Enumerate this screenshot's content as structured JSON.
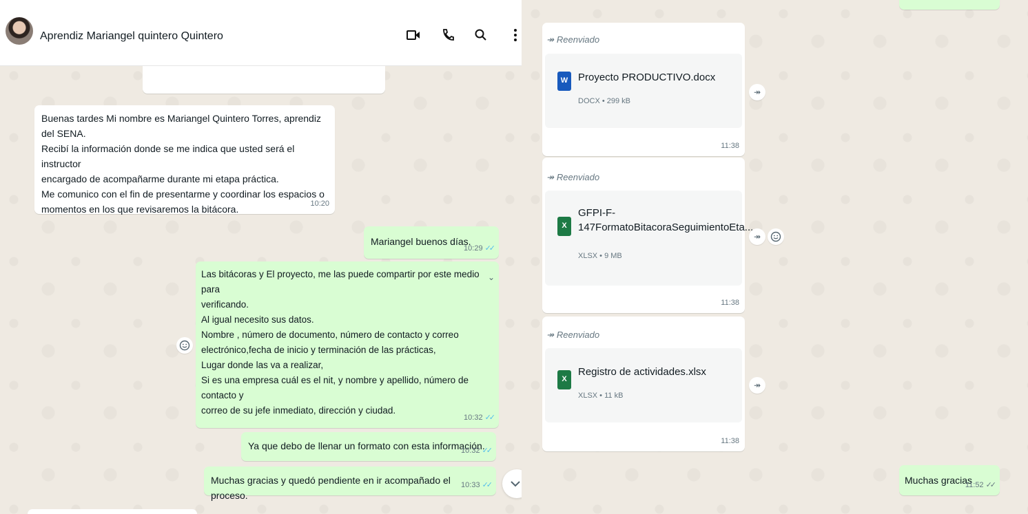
{
  "header": {
    "contact_name": "Aprendiz Mariangel quintero Quintero",
    "icons": [
      "video-call-icon",
      "voice-call-icon",
      "search-icon",
      "menu-icon"
    ]
  },
  "left_messages": [
    {
      "direction": "in",
      "text": "Buenas tardes Mi nombre es Mariangel Quintero Torres, aprendiz del SENA.\nRecibí la información donde se me indica que usted será el instructor\nencargado de acompañarme durante mi etapa práctica.\nMe comunico con el fin de presentarme y coordinar los espacios o\nmomentos en los que revisaremos la bitácora.",
      "time": "10:20"
    },
    {
      "direction": "out",
      "text": "Mariangel buenos días.",
      "time": "10:29"
    },
    {
      "direction": "out",
      "text": "Las bitácoras y  El proyecto, me las puede compartir por este medio para\nverificando.\nAl igual necesito sus datos.\nNombre , número de documento, número de contacto y correo\nelectrónico,fecha de inicio y terminación de las prácticas,\nLugar donde las va a realizar,\nSi es una empresa cuál es el nit, y nombre y apellido, número de contacto y\ncorreo de su jefe inmediato, dirección y ciudad.",
      "time": "10:32"
    },
    {
      "direction": "out",
      "text": "Ya que debo de llenar un formato con esta información.",
      "time": "10:32"
    },
    {
      "direction": "out",
      "text": "Muchas gracias y quedó pendiente en ir acompañado el proceso.",
      "time": "10:33"
    }
  ],
  "right_messages": [
    {
      "forward_label": "Reenviado",
      "file_name": "Proyecto PRODUCTIVO.docx",
      "file_info": "DOCX • 299 kB",
      "file_badge": "W",
      "file_color": "#185abd",
      "time": "11:38"
    },
    {
      "forward_label": "Reenviado",
      "file_name": "GFPI-F-\n147FormatoBitacoraSeguimientoEta...",
      "file_info": "XLSX • 9 MB",
      "file_badge": "X",
      "file_color": "#1d7a45",
      "time": "11:38"
    },
    {
      "forward_label": "Reenviado",
      "file_name": "Registro de actividades.xlsx",
      "file_info": "XLSX • 11 kB",
      "file_badge": "X",
      "file_color": "#1d7a45",
      "time": "11:38"
    },
    {
      "direction": "out",
      "text": "Muchas gracias",
      "time": "11:52"
    }
  ],
  "colors": {
    "incoming": "#ffffff",
    "outgoing": "#d9fdd3",
    "background": "#efeae2",
    "read_ticks": "#53bdeb"
  }
}
